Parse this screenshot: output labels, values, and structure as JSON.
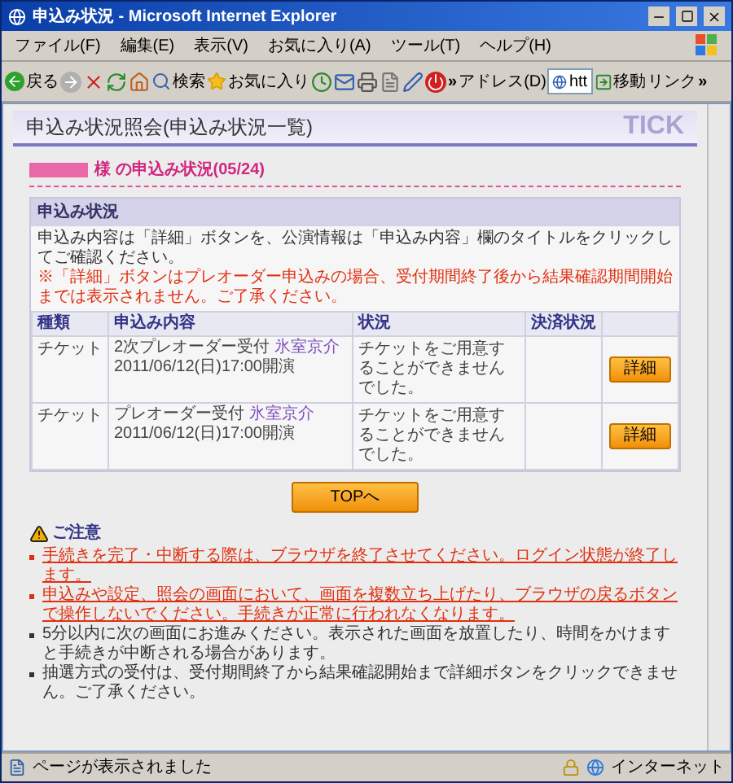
{
  "window": {
    "title": "申込み状況 - Microsoft Internet Explorer"
  },
  "menu": [
    "ファイル(F)",
    "編集(E)",
    "表示(V)",
    "お気に入り(A)",
    "ツール(T)",
    "ヘルプ(H)"
  ],
  "toolbar": {
    "back": "戻る",
    "search": "検索",
    "favorites": "お気に入り",
    "more": "»",
    "address_label": "アドレス(D)",
    "address_value": "htt",
    "go": "移動",
    "links": "リンク",
    "links_more": "»"
  },
  "page": {
    "title": "申込み状況照会(申込み状況一覧)",
    "logo": "TICK",
    "heading": "様 の申込み状況(05/24)",
    "panel": {
      "title": "申込み状況",
      "instruction": "申込み内容は「詳細」ボタンを、公演情報は「申込み内容」欄のタイトルをクリックしてご確認ください。",
      "note": "※「詳細」ボタンはプレオーダー申込みの場合、受付期間終了後から結果確認期間開始までは表示されません。ご了承ください。",
      "columns": [
        "種類",
        "申込み内容",
        "状況",
        "決済状況"
      ],
      "rows": [
        {
          "type": "チケット",
          "entry": "2次プレオーダー受付",
          "artist": "氷室京介",
          "date": "2011/06/12(日)17:00開演",
          "status": "チケットをご用意することができませんでした。",
          "button": "詳細"
        },
        {
          "type": "チケット",
          "entry": "プレオーダー受付",
          "artist": "氷室京介",
          "date": "2011/06/12(日)17:00開演",
          "status": "チケットをご用意することができませんでした。",
          "button": "詳細"
        }
      ]
    },
    "top_button": "TOPへ",
    "notice": {
      "title": "ご注意",
      "items": [
        {
          "kind": "warning",
          "text": "手続きを完了・中断する際は、ブラウザを終了させてください。ログイン状態が終了します。"
        },
        {
          "kind": "warning",
          "text": "申込みや設定、照会の画面において、画面を複数立ち上げたり、ブラウザの戻るボタンで操作しないでください。手続きが正常に行われなくなります。"
        },
        {
          "kind": "normal",
          "text": "5分以内に次の画面にお進みください。表示された画面を放置したり、時間をかけますと手続きが中断される場合があります。"
        },
        {
          "kind": "normal",
          "text": "抽選方式の受付は、受付期間終了から結果確認開始まで詳細ボタンをクリックできません。ご了承ください。"
        }
      ]
    }
  },
  "status_bar": {
    "text": "ページが表示されました",
    "zone": "インターネット"
  }
}
